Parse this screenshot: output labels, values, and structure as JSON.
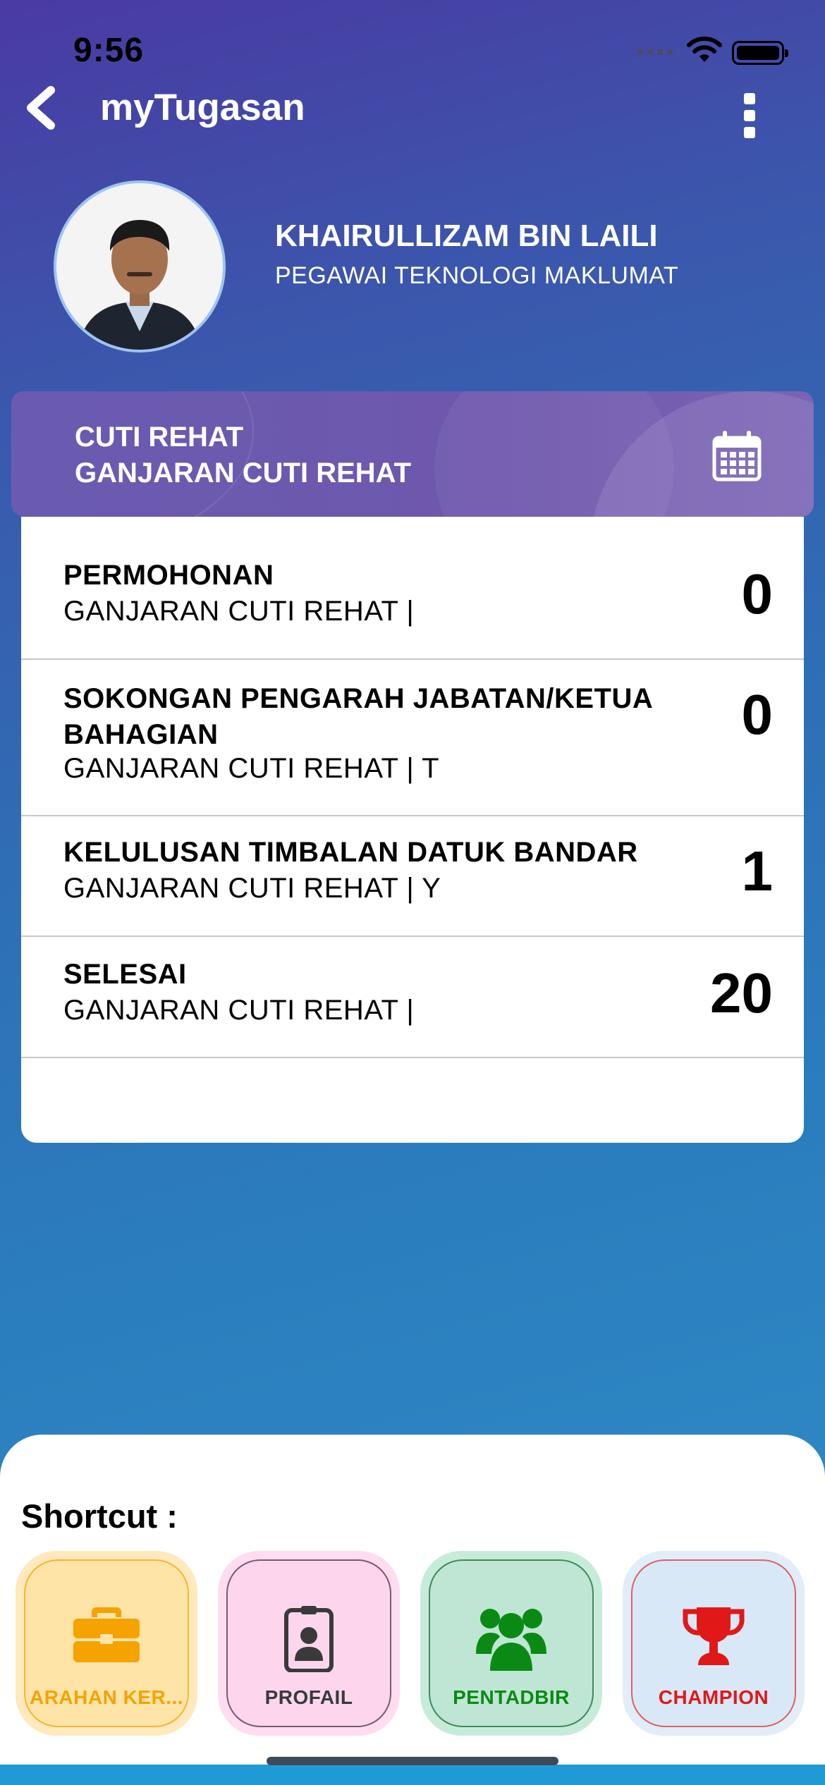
{
  "status_bar": {
    "time": "9:56"
  },
  "header": {
    "title": "myTugasan"
  },
  "profile": {
    "name": "KHAIRULLIZAM BIN LAILI",
    "position": "PEGAWAI TEKNOLOGI MAKLUMAT"
  },
  "banner": {
    "line1": "CUTI REHAT",
    "line2": "GANJARAN CUTI REHAT",
    "icon": "calendar-icon"
  },
  "list": {
    "rows": [
      {
        "title": "PERMOHONAN",
        "subtitle": "GANJARAN CUTI REHAT |",
        "count": "0"
      },
      {
        "title": "SOKONGAN PENGARAH JABATAN/KETUA BAHAGIAN",
        "subtitle": "GANJARAN CUTI REHAT | T",
        "count": "0"
      },
      {
        "title": "KELULUSAN TIMBALAN DATUK BANDAR",
        "subtitle": "GANJARAN CUTI REHAT | Y",
        "count": "1"
      },
      {
        "title": "SELESAI",
        "subtitle": "GANJARAN CUTI REHAT |",
        "count": "20"
      }
    ]
  },
  "shortcuts": {
    "title": "Shortcut :",
    "items": [
      {
        "label": "ARAHAN KER...",
        "icon": "briefcase-icon",
        "color": "#f5a300",
        "bg": "#ffe4a8"
      },
      {
        "label": "PROFAIL",
        "icon": "id-badge-icon",
        "color": "#3a3a3a",
        "bg": "#fdd6ee"
      },
      {
        "label": "PENTADBIR",
        "icon": "users-icon",
        "color": "#0a8a14",
        "bg": "#bfe5d4"
      },
      {
        "label": "CHAMPION",
        "icon": "trophy-icon",
        "color": "#e01818",
        "bg": "#d9e8f6"
      }
    ]
  }
}
